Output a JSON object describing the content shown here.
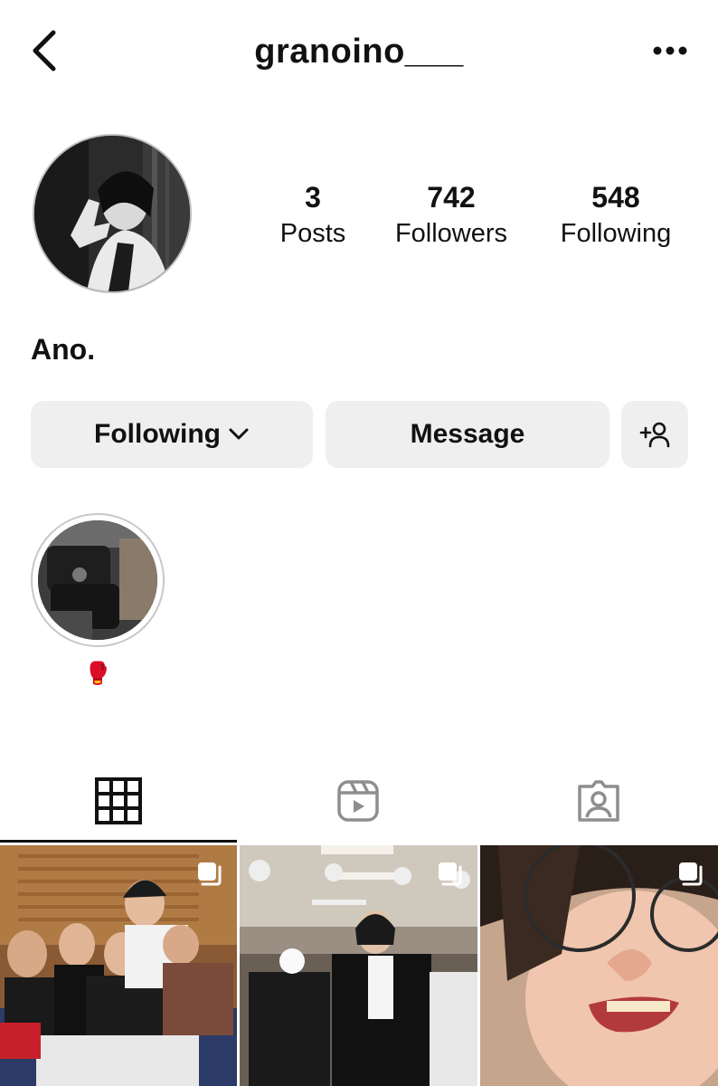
{
  "header": {
    "username": "granoino___"
  },
  "stats": [
    {
      "value": "3",
      "label": "Posts"
    },
    {
      "value": "742",
      "label": "Followers"
    },
    {
      "value": "548",
      "label": "Following"
    }
  ],
  "bio": {
    "name": "Ano."
  },
  "actions": {
    "following_label": "Following",
    "message_label": "Message"
  },
  "highlights": [
    {
      "label": "🥊"
    }
  ],
  "tabs": [
    "posts-grid",
    "reels",
    "tagged"
  ],
  "colors": {
    "text": "#111111",
    "button_bg": "#efefef",
    "ring": "#c8c8c8",
    "tab_inactive": "#8e8e8e"
  }
}
